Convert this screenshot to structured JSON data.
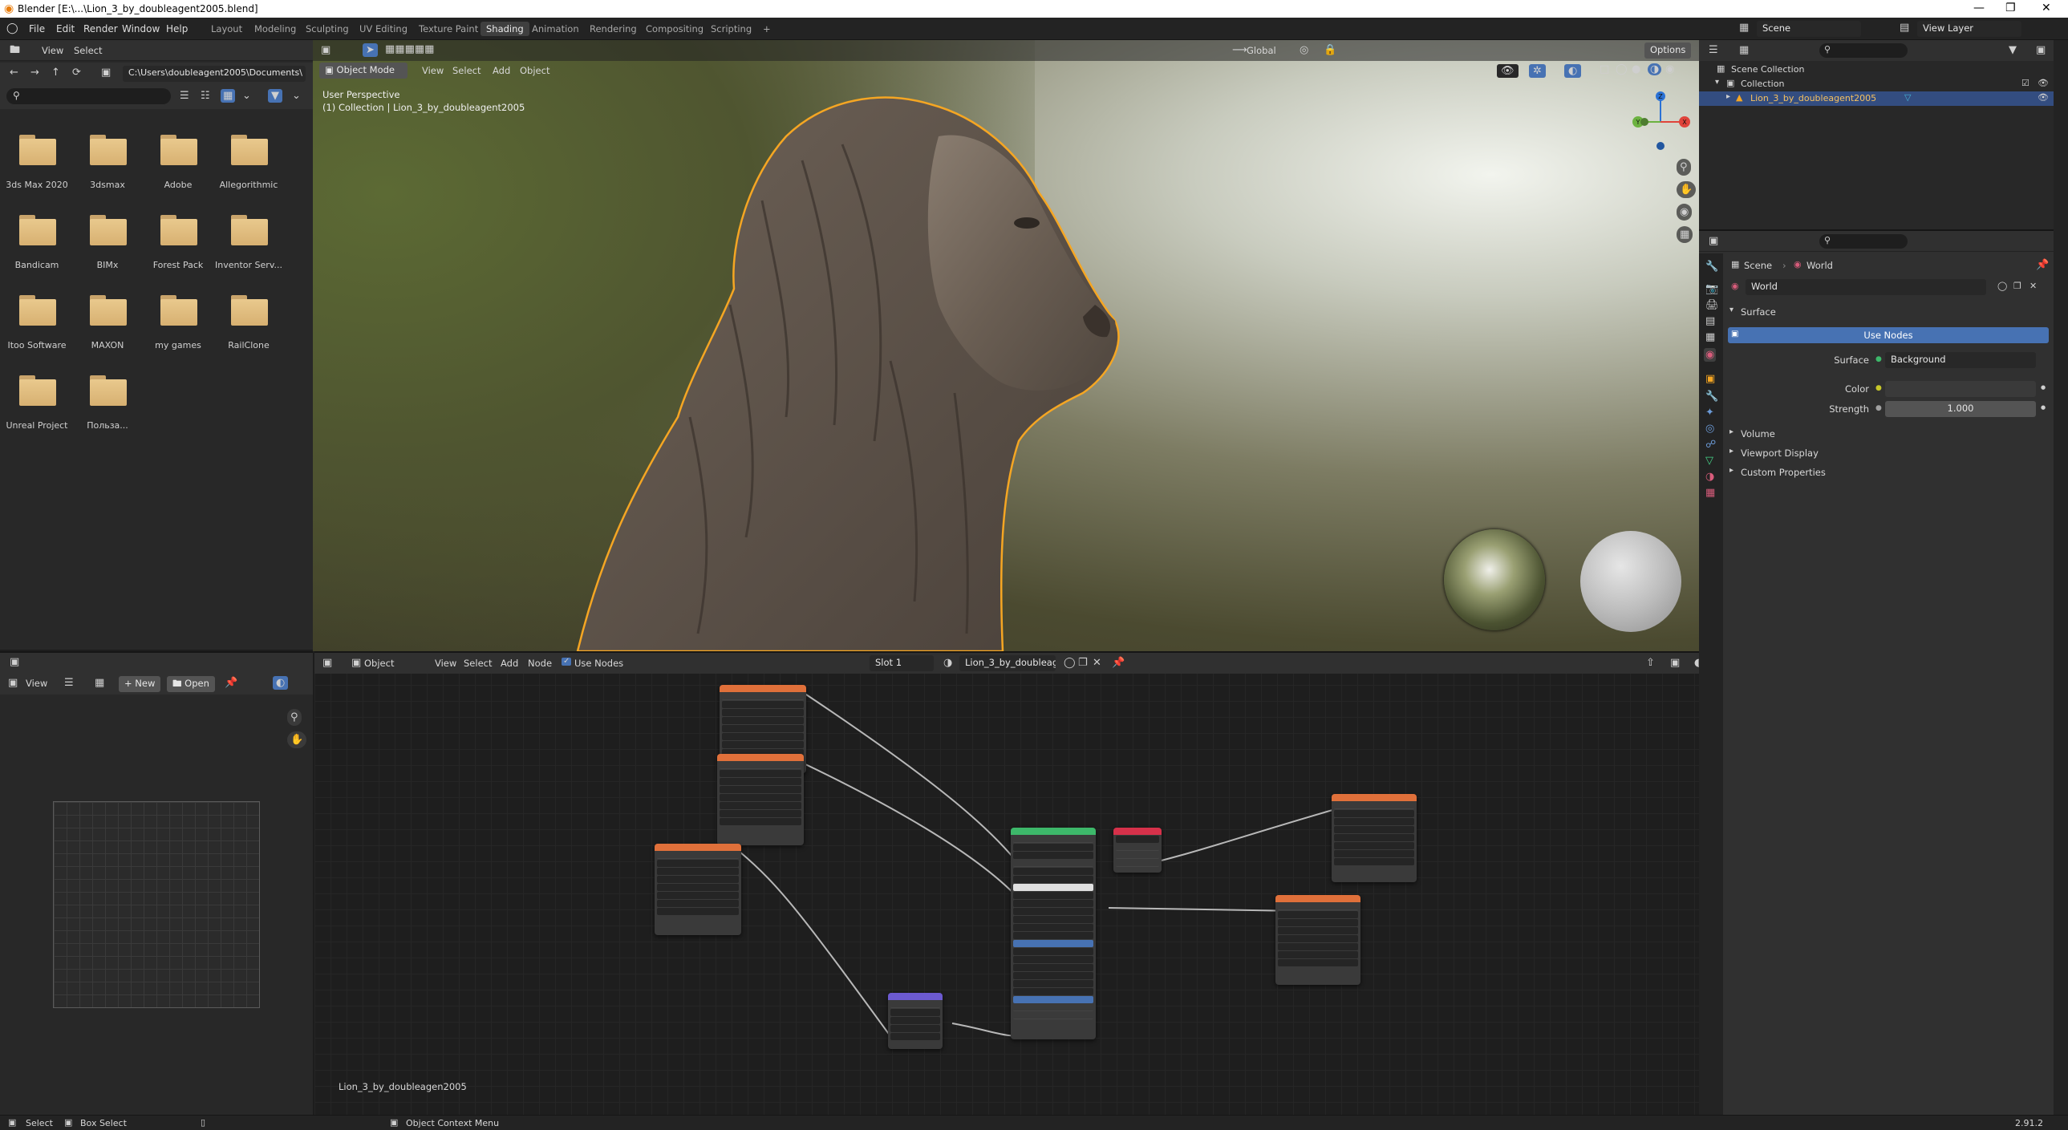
{
  "window": {
    "title": "Blender [E:\\...\\Lion_3_by_doubleagent2005.blend]",
    "controls": [
      "—",
      "❐",
      "✕"
    ]
  },
  "menubar": {
    "items": [
      "File",
      "Edit",
      "Render",
      "Window",
      "Help"
    ],
    "workspaces": [
      "Layout",
      "Modeling",
      "Sculpting",
      "UV Editing",
      "Texture Paint",
      "Shading",
      "Animation",
      "Rendering",
      "Compositing",
      "Scripting"
    ],
    "active_workspace": "Shading",
    "add_tab": "+",
    "scene_name": "Scene",
    "view_layer": "View Layer"
  },
  "filebrowser": {
    "menu": [
      "View",
      "Select"
    ],
    "path": "C:\\Users\\doubleagent2005\\Documents\\",
    "folders": [
      "3ds Max 2020",
      "3dsmax",
      "Adobe",
      "Allegorithmic",
      "Bandicam",
      "BIMx",
      "Forest Pack",
      "Inventor Serv...",
      "Itoo Software",
      "MAXON",
      "my games",
      "RailClone",
      "Unreal Project",
      "Польза..."
    ]
  },
  "viewport": {
    "mode": "Object Mode",
    "menu": [
      "View",
      "Select",
      "Add",
      "Object"
    ],
    "orientation": "Global",
    "options_label": "Options",
    "info_line1": "User Perspective",
    "info_line2": "(1) Collection | Lion_3_by_doubleagent2005",
    "gizmo": {
      "z": "Z",
      "x": "X",
      "y": "Y"
    }
  },
  "imageeditor": {
    "view_label": "View",
    "new_label": "New",
    "open_label": "Open"
  },
  "nodeeditor": {
    "object_label": "Object",
    "menu": [
      "View",
      "Select",
      "Add",
      "Node"
    ],
    "use_nodes_label": "Use Nodes",
    "slot": "Slot 1",
    "material": "Lion_3_by_doubleag...",
    "material_footer": "Lion_3_by_doubleagen2005"
  },
  "outliner": {
    "scene_collection": "Scene Collection",
    "collection": "Collection",
    "object": "Lion_3_by_doubleagent2005"
  },
  "properties": {
    "breadcrumb_scene": "Scene",
    "breadcrumb_world": "World",
    "world_name": "World",
    "surface_panel": "Surface",
    "use_nodes": "Use Nodes",
    "surface_label": "Surface",
    "surface_value": "Background",
    "color_label": "Color",
    "strength_label": "Strength",
    "strength_value": "1.000",
    "volume_panel": "Volume",
    "viewport_display_panel": "Viewport Display",
    "custom_properties_panel": "Custom Properties"
  },
  "statusbar": {
    "select": "Select",
    "box_select": "Box Select",
    "context_menu": "Object Context Menu",
    "version": "2.91.2"
  },
  "colors": {
    "accent_blue": "#4772b3",
    "selection_orange": "#f5a623",
    "folder": "#e1bd7e",
    "image_node": "#e0703a",
    "shader_node": "#3db86a",
    "output_node": "#d6314a",
    "vector_node": "#6c5ad0"
  }
}
